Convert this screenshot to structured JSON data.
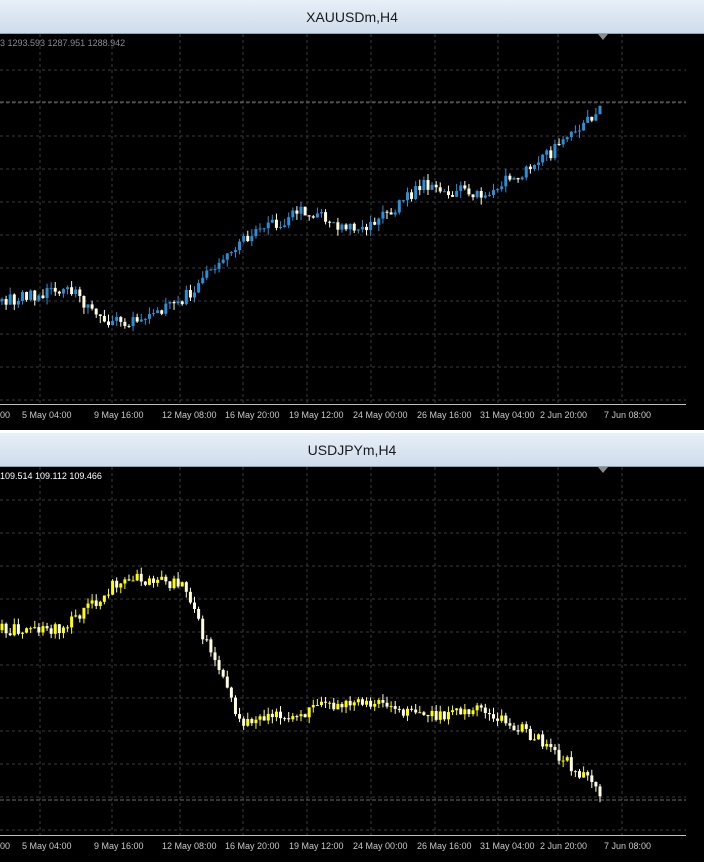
{
  "charts": [
    {
      "title": "XAUUSDm,H4",
      "ohlc_text": "3 1293.593 1287.951 1288.942",
      "ohlc_color": "#8a8a8a",
      "up_color": "#2a8fd6",
      "down_color": "#ffffe0",
      "grid_color": "#3a3a3a",
      "x_ticks": [
        "00",
        "5 May 04:00",
        "9 May 16:00",
        "12 May 08:00",
        "16 May 20:00",
        "19 May 12:00",
        "24 May 00:00",
        "26 May 16:00",
        "31 May 04:00",
        "2 Jun 20:00",
        "7 Jun 08:00"
      ]
    },
    {
      "title": "USDJPYm,H4",
      "ohlc_text": "109.514 109.112 109.466",
      "ohlc_color": "#ffffff",
      "up_color": "#ffff00",
      "down_color": "#ffffe0",
      "grid_color": "#3a3a3a",
      "x_ticks": [
        "00",
        "5 May 04:00",
        "9 May 16:00",
        "12 May 08:00",
        "16 May 20:00",
        "19 May 12:00",
        "24 May 00:00",
        "26 May 16:00",
        "31 May 04:00",
        "2 Jun 20:00",
        "7 Jun 08:00"
      ]
    }
  ],
  "chart_data": [
    {
      "type": "line",
      "title": "XAUUSDm,H4",
      "x": [
        "00",
        "5 May 04:00",
        "9 May 16:00",
        "12 May 08:00",
        "16 May 20:00",
        "19 May 12:00",
        "24 May 00:00",
        "26 May 16:00",
        "31 May 04:00",
        "2 Jun 20:00",
        "7 Jun 08:00"
      ],
      "series": [
        {
          "values": [
            0.3,
            0.35,
            0.21,
            0.3,
            0.52,
            0.62,
            0.54,
            0.71,
            0.68,
            0.79,
            0.98
          ]
        }
      ],
      "ylim": [
        0,
        1
      ],
      "grid": true
    },
    {
      "type": "line",
      "title": "USDJPYm,H4",
      "x": [
        "00",
        "5 May 04:00",
        "9 May 16:00",
        "12 May 08:00",
        "16 May 20:00",
        "19 May 12:00",
        "24 May 00:00",
        "26 May 16:00",
        "31 May 04:00",
        "2 Jun 20:00",
        "7 Jun 08:00"
      ],
      "series": [
        {
          "values": [
            0.68,
            0.68,
            0.88,
            0.86,
            0.32,
            0.36,
            0.42,
            0.35,
            0.38,
            0.26,
            0.06
          ]
        }
      ],
      "ylim": [
        0,
        1
      ],
      "grid": true
    }
  ]
}
